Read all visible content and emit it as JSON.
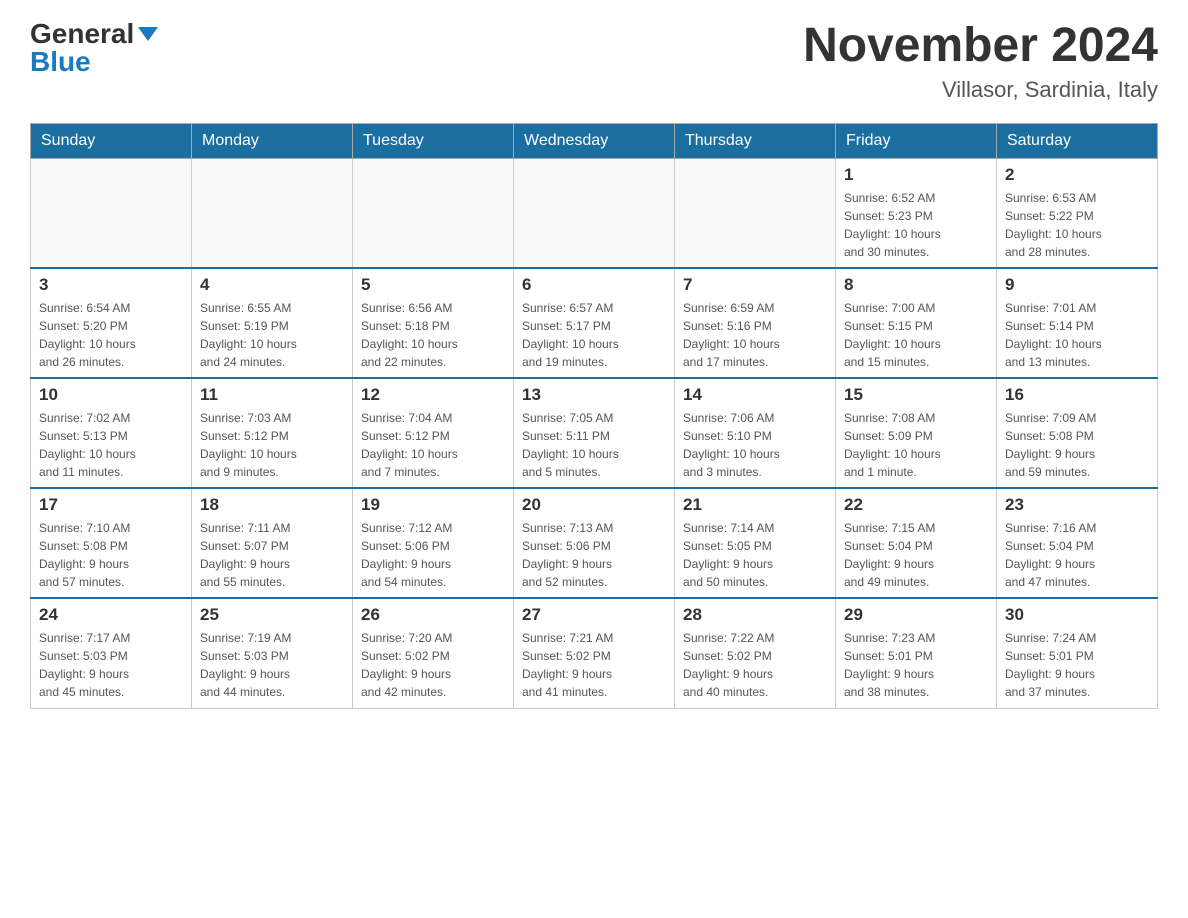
{
  "logo": {
    "general": "General",
    "blue": "Blue"
  },
  "title": "November 2024",
  "location": "Villasor, Sardinia, Italy",
  "days_of_week": [
    "Sunday",
    "Monday",
    "Tuesday",
    "Wednesday",
    "Thursday",
    "Friday",
    "Saturday"
  ],
  "weeks": [
    [
      {
        "day": "",
        "info": ""
      },
      {
        "day": "",
        "info": ""
      },
      {
        "day": "",
        "info": ""
      },
      {
        "day": "",
        "info": ""
      },
      {
        "day": "",
        "info": ""
      },
      {
        "day": "1",
        "info": "Sunrise: 6:52 AM\nSunset: 5:23 PM\nDaylight: 10 hours\nand 30 minutes."
      },
      {
        "day": "2",
        "info": "Sunrise: 6:53 AM\nSunset: 5:22 PM\nDaylight: 10 hours\nand 28 minutes."
      }
    ],
    [
      {
        "day": "3",
        "info": "Sunrise: 6:54 AM\nSunset: 5:20 PM\nDaylight: 10 hours\nand 26 minutes."
      },
      {
        "day": "4",
        "info": "Sunrise: 6:55 AM\nSunset: 5:19 PM\nDaylight: 10 hours\nand 24 minutes."
      },
      {
        "day": "5",
        "info": "Sunrise: 6:56 AM\nSunset: 5:18 PM\nDaylight: 10 hours\nand 22 minutes."
      },
      {
        "day": "6",
        "info": "Sunrise: 6:57 AM\nSunset: 5:17 PM\nDaylight: 10 hours\nand 19 minutes."
      },
      {
        "day": "7",
        "info": "Sunrise: 6:59 AM\nSunset: 5:16 PM\nDaylight: 10 hours\nand 17 minutes."
      },
      {
        "day": "8",
        "info": "Sunrise: 7:00 AM\nSunset: 5:15 PM\nDaylight: 10 hours\nand 15 minutes."
      },
      {
        "day": "9",
        "info": "Sunrise: 7:01 AM\nSunset: 5:14 PM\nDaylight: 10 hours\nand 13 minutes."
      }
    ],
    [
      {
        "day": "10",
        "info": "Sunrise: 7:02 AM\nSunset: 5:13 PM\nDaylight: 10 hours\nand 11 minutes."
      },
      {
        "day": "11",
        "info": "Sunrise: 7:03 AM\nSunset: 5:12 PM\nDaylight: 10 hours\nand 9 minutes."
      },
      {
        "day": "12",
        "info": "Sunrise: 7:04 AM\nSunset: 5:12 PM\nDaylight: 10 hours\nand 7 minutes."
      },
      {
        "day": "13",
        "info": "Sunrise: 7:05 AM\nSunset: 5:11 PM\nDaylight: 10 hours\nand 5 minutes."
      },
      {
        "day": "14",
        "info": "Sunrise: 7:06 AM\nSunset: 5:10 PM\nDaylight: 10 hours\nand 3 minutes."
      },
      {
        "day": "15",
        "info": "Sunrise: 7:08 AM\nSunset: 5:09 PM\nDaylight: 10 hours\nand 1 minute."
      },
      {
        "day": "16",
        "info": "Sunrise: 7:09 AM\nSunset: 5:08 PM\nDaylight: 9 hours\nand 59 minutes."
      }
    ],
    [
      {
        "day": "17",
        "info": "Sunrise: 7:10 AM\nSunset: 5:08 PM\nDaylight: 9 hours\nand 57 minutes."
      },
      {
        "day": "18",
        "info": "Sunrise: 7:11 AM\nSunset: 5:07 PM\nDaylight: 9 hours\nand 55 minutes."
      },
      {
        "day": "19",
        "info": "Sunrise: 7:12 AM\nSunset: 5:06 PM\nDaylight: 9 hours\nand 54 minutes."
      },
      {
        "day": "20",
        "info": "Sunrise: 7:13 AM\nSunset: 5:06 PM\nDaylight: 9 hours\nand 52 minutes."
      },
      {
        "day": "21",
        "info": "Sunrise: 7:14 AM\nSunset: 5:05 PM\nDaylight: 9 hours\nand 50 minutes."
      },
      {
        "day": "22",
        "info": "Sunrise: 7:15 AM\nSunset: 5:04 PM\nDaylight: 9 hours\nand 49 minutes."
      },
      {
        "day": "23",
        "info": "Sunrise: 7:16 AM\nSunset: 5:04 PM\nDaylight: 9 hours\nand 47 minutes."
      }
    ],
    [
      {
        "day": "24",
        "info": "Sunrise: 7:17 AM\nSunset: 5:03 PM\nDaylight: 9 hours\nand 45 minutes."
      },
      {
        "day": "25",
        "info": "Sunrise: 7:19 AM\nSunset: 5:03 PM\nDaylight: 9 hours\nand 44 minutes."
      },
      {
        "day": "26",
        "info": "Sunrise: 7:20 AM\nSunset: 5:02 PM\nDaylight: 9 hours\nand 42 minutes."
      },
      {
        "day": "27",
        "info": "Sunrise: 7:21 AM\nSunset: 5:02 PM\nDaylight: 9 hours\nand 41 minutes."
      },
      {
        "day": "28",
        "info": "Sunrise: 7:22 AM\nSunset: 5:02 PM\nDaylight: 9 hours\nand 40 minutes."
      },
      {
        "day": "29",
        "info": "Sunrise: 7:23 AM\nSunset: 5:01 PM\nDaylight: 9 hours\nand 38 minutes."
      },
      {
        "day": "30",
        "info": "Sunrise: 7:24 AM\nSunset: 5:01 PM\nDaylight: 9 hours\nand 37 minutes."
      }
    ]
  ]
}
